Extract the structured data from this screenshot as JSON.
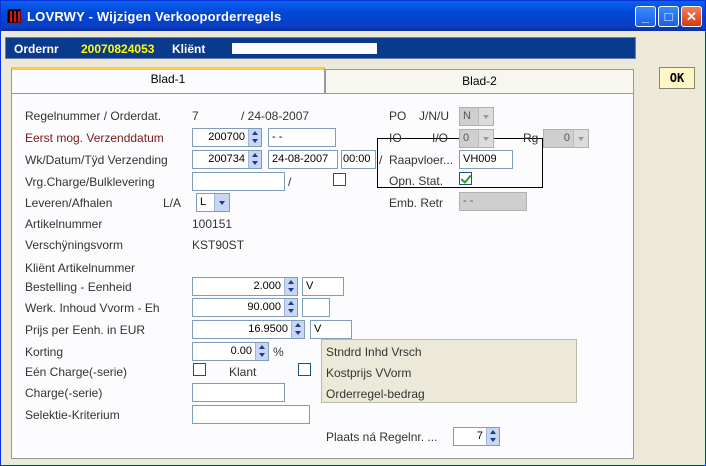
{
  "window": {
    "title": "LOVRWY - Wijzigen Verkooporderregels",
    "minimize": "_",
    "maximize": "□",
    "close": "✕"
  },
  "header": {
    "order_label": "Ordernr",
    "order_value": "20070824053",
    "client_label": "Kliënt"
  },
  "ok_label": "OK",
  "tabs": [
    {
      "label": "Blad-1"
    },
    {
      "label": "Blad-2"
    }
  ],
  "form": {
    "regelnummer_label": "Regelnummer / Orderdat.",
    "regelnummer_value": "7",
    "orderdat_value": "/ 24-08-2007",
    "eerst_mog_label": "Eerst mog. Verzenddatum",
    "eerst_mog_week": "200700",
    "eerst_mog_date": "- -",
    "wk_label": "Wk/Datum/Tÿd Verzending",
    "wk_week": "200734",
    "wk_date": "24-08-2007",
    "wk_time": "00:00",
    "slash": "/",
    "vrg_label": "Vrg.Charge/Bulklevering",
    "vrg_slash": "/",
    "leveren_label": "Leveren/Afhalen",
    "la_label": "L/A",
    "la_value": "L",
    "artikel_label": "Artikelnummer",
    "artikel_value": "100151",
    "verschijning_label": "Verschÿningsvorm",
    "verschijning_value": "KST90ST",
    "klient_artikel_label": "Kliënt Artikelnummer",
    "bestelling_label": "Bestelling - Eenheid",
    "bestelling_value": "2.000",
    "bestelling_unit": "V",
    "werk_label": "Werk. Inhoud Vvorm - Eh",
    "werk_value": "90.000",
    "prijs_label": "Prijs per Eenh. in EUR",
    "prijs_value": "16.9500",
    "prijs_unit": "V",
    "korting_label": "Korting",
    "korting_value": "0.00",
    "korting_unit": "%",
    "een_charge_label": "Eén Charge(-serie)",
    "klant_label": "Klant",
    "charge_label": "Charge(-serie)",
    "selectie_label": "Selektie-Kriterium",
    "po_label": "PO",
    "jnu_label": "J/N/U",
    "po_value": "N",
    "io_label": "IO",
    "io2_label": "I/O",
    "io_value": "0",
    "rg_label": "Rg",
    "rg_value": "0",
    "raapvloer_label": "Raapvloer...",
    "raapvloer_value": "VH009",
    "opn_stat_label": "Opn. Stat.",
    "emb_retr_label": "Emb. Retr",
    "emb_retr_value": "- -",
    "stndrd_label": "Stndrd Inhd Vrsch",
    "kostprijs_label": "Kostprijs VVorm",
    "orderregel_label": "Orderregel-bedrag",
    "plaats_label": "Plaats ná Regelnr. ...",
    "plaats_value": "7"
  },
  "colors": {
    "titlebar": "#0a55e6",
    "header_bar": "#0a3a8c",
    "order_value": "#ffff00",
    "tab_accent": "#ffc83c",
    "ok_button": "#fff6c8"
  }
}
